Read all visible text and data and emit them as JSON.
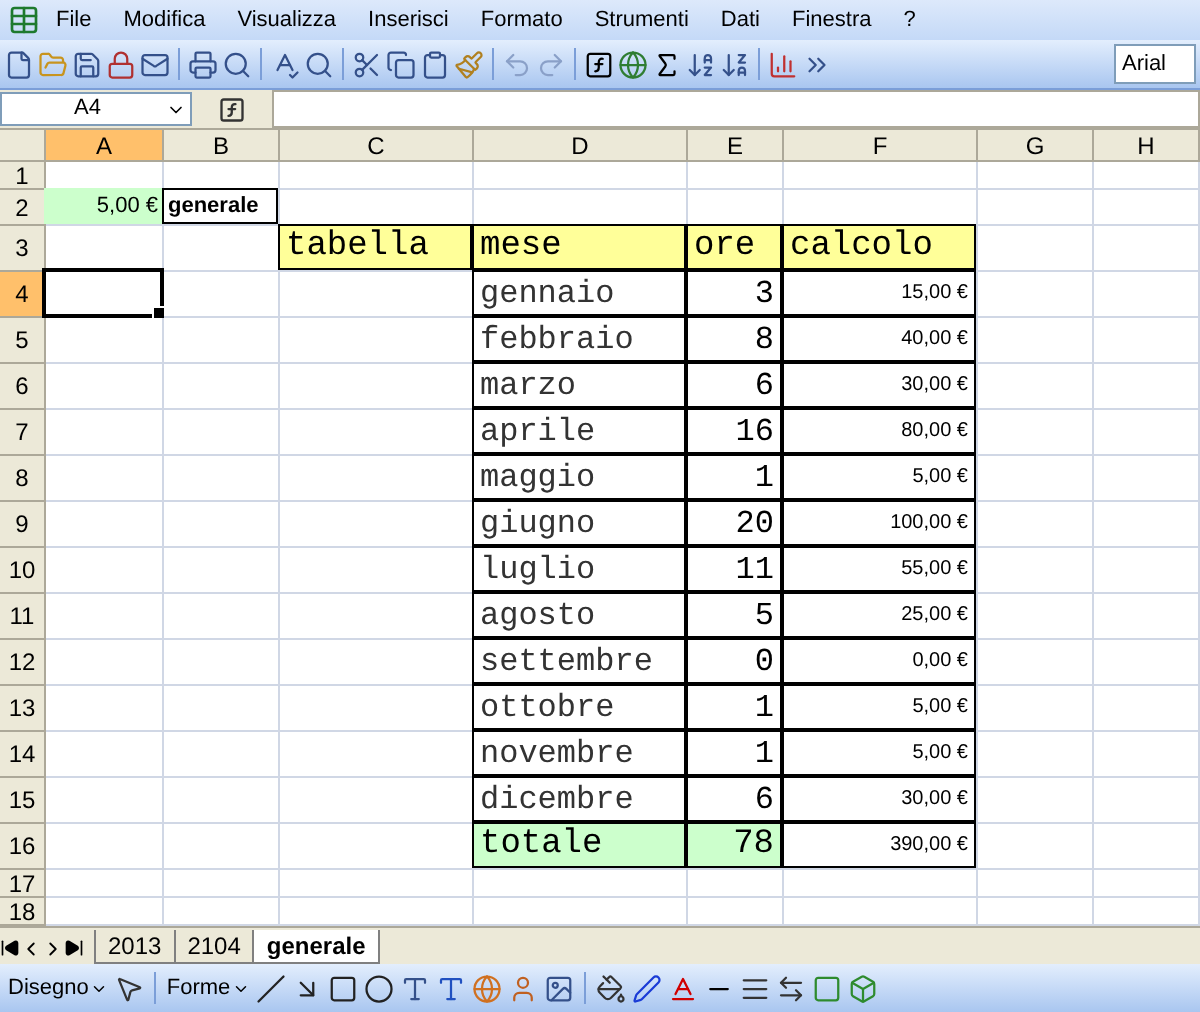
{
  "menu": [
    "File",
    "Modifica",
    "Visualizza",
    "Inserisci",
    "Formato",
    "Strumenti",
    "Dati",
    "Finestra",
    "?"
  ],
  "toolbar": {
    "font": "Arial"
  },
  "formula_bar": {
    "name_box": "A4"
  },
  "grid": {
    "columns": [
      {
        "label": "A",
        "selected": true
      },
      {
        "label": "B",
        "selected": false
      },
      {
        "label": "C",
        "selected": false
      },
      {
        "label": "D",
        "selected": false
      },
      {
        "label": "E",
        "selected": false
      },
      {
        "label": "F",
        "selected": false
      },
      {
        "label": "G",
        "selected": false
      },
      {
        "label": "H",
        "selected": false
      }
    ],
    "rows": [
      {
        "label": "1",
        "selected": false,
        "cells": {}
      },
      {
        "label": "2",
        "selected": false,
        "cells": {
          "A": {
            "text": "5,00 €",
            "kind": "input"
          },
          "B": {
            "text": "generale",
            "kind": "label"
          }
        }
      },
      {
        "label": "3",
        "selected": false,
        "cells": {
          "C": {
            "text": "tabella",
            "kind": "header"
          },
          "D": {
            "text": "mese",
            "kind": "header"
          },
          "E": {
            "text": "ore",
            "kind": "header"
          },
          "F": {
            "text": "calcolo",
            "kind": "header"
          }
        }
      },
      {
        "label": "4",
        "selected": true,
        "cells": {
          "D": {
            "text": "gennaio",
            "kind": "text"
          },
          "E": {
            "text": "3",
            "kind": "number"
          },
          "F": {
            "text": "15,00 €",
            "kind": "money"
          }
        }
      },
      {
        "label": "5",
        "selected": false,
        "cells": {
          "D": {
            "text": "febbraio",
            "kind": "text"
          },
          "E": {
            "text": "8",
            "kind": "number"
          },
          "F": {
            "text": "40,00 €",
            "kind": "money"
          }
        }
      },
      {
        "label": "6",
        "selected": false,
        "cells": {
          "D": {
            "text": "marzo",
            "kind": "text"
          },
          "E": {
            "text": "6",
            "kind": "number"
          },
          "F": {
            "text": "30,00 €",
            "kind": "money"
          }
        }
      },
      {
        "label": "7",
        "selected": false,
        "cells": {
          "D": {
            "text": "aprile",
            "kind": "text"
          },
          "E": {
            "text": "16",
            "kind": "number"
          },
          "F": {
            "text": "80,00 €",
            "kind": "money"
          }
        }
      },
      {
        "label": "8",
        "selected": false,
        "cells": {
          "D": {
            "text": "maggio",
            "kind": "text"
          },
          "E": {
            "text": "1",
            "kind": "number"
          },
          "F": {
            "text": "5,00 €",
            "kind": "money"
          }
        }
      },
      {
        "label": "9",
        "selected": false,
        "cells": {
          "D": {
            "text": "giugno",
            "kind": "text"
          },
          "E": {
            "text": "20",
            "kind": "number"
          },
          "F": {
            "text": "100,00 €",
            "kind": "money"
          }
        }
      },
      {
        "label": "10",
        "selected": false,
        "cells": {
          "D": {
            "text": "luglio",
            "kind": "text"
          },
          "E": {
            "text": "11",
            "kind": "number"
          },
          "F": {
            "text": "55,00 €",
            "kind": "money"
          }
        }
      },
      {
        "label": "11",
        "selected": false,
        "cells": {
          "D": {
            "text": "agosto",
            "kind": "text"
          },
          "E": {
            "text": "5",
            "kind": "number"
          },
          "F": {
            "text": "25,00 €",
            "kind": "money"
          }
        }
      },
      {
        "label": "12",
        "selected": false,
        "cells": {
          "D": {
            "text": "settembre",
            "kind": "text"
          },
          "E": {
            "text": "0",
            "kind": "number"
          },
          "F": {
            "text": "0,00 €",
            "kind": "money"
          }
        }
      },
      {
        "label": "13",
        "selected": false,
        "cells": {
          "D": {
            "text": "ottobre",
            "kind": "text"
          },
          "E": {
            "text": "1",
            "kind": "number"
          },
          "F": {
            "text": "5,00 €",
            "kind": "money"
          }
        }
      },
      {
        "label": "14",
        "selected": false,
        "cells": {
          "D": {
            "text": "novembre",
            "kind": "text"
          },
          "E": {
            "text": "1",
            "kind": "number"
          },
          "F": {
            "text": "5,00 €",
            "kind": "money"
          }
        }
      },
      {
        "label": "15",
        "selected": false,
        "cells": {
          "D": {
            "text": "dicembre",
            "kind": "text"
          },
          "E": {
            "text": "6",
            "kind": "number"
          },
          "F": {
            "text": "30,00 €",
            "kind": "money"
          }
        }
      },
      {
        "label": "16",
        "selected": false,
        "cells": {
          "D": {
            "text": "totale",
            "kind": "total"
          },
          "E": {
            "text": "78",
            "kind": "total-number"
          },
          "F": {
            "text": "390,00 €",
            "kind": "money"
          }
        }
      },
      {
        "label": "17",
        "selected": false,
        "cells": {}
      },
      {
        "label": "18",
        "selected": false,
        "cells": {}
      }
    ]
  },
  "sheet_tabs": [
    {
      "label": "2013",
      "selected": false
    },
    {
      "label": "2104",
      "selected": false
    },
    {
      "label": "generale",
      "selected": true
    }
  ],
  "drawing_toolbar": {
    "draw_menu": "Disegno",
    "shapes_menu": "Forme"
  }
}
